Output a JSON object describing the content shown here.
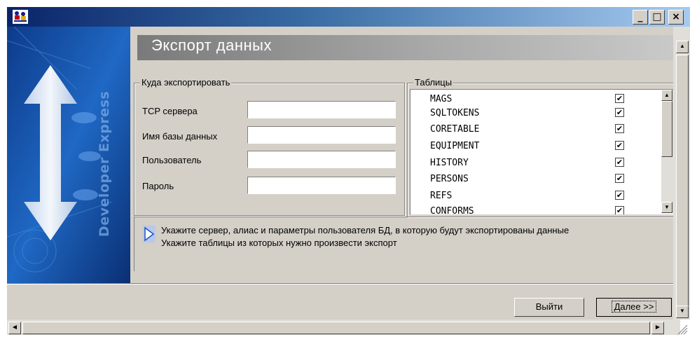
{
  "window": {
    "icon": "app-people-icon",
    "minimize_glyph": "_",
    "maximize_glyph": "□",
    "close_glyph": "×"
  },
  "sidebar_art": {
    "brand_text": "Developer Express",
    "icon": "updown-arrow-icon"
  },
  "header": {
    "title": "Экспорт данных"
  },
  "destination": {
    "legend": "Куда экспортировать",
    "fields": {
      "server_label": "TCP сервера",
      "server_value": "",
      "database_label": "Имя базы данных",
      "database_value": "",
      "user_label": "Пользователь",
      "user_value": "",
      "password_label": "Пароль",
      "password_value": ""
    }
  },
  "tables": {
    "legend": "Таблицы",
    "items": [
      {
        "name": "MAGS",
        "checked": true
      },
      {
        "name": "SQLTOKENS",
        "checked": true
      },
      {
        "name": "CORETABLE",
        "checked": true
      },
      {
        "name": "EQUIPMENT",
        "checked": true
      },
      {
        "name": "HISTORY",
        "checked": true
      },
      {
        "name": "PERSONS",
        "checked": true
      },
      {
        "name": "REFS",
        "checked": true
      },
      {
        "name": "CONFORMS",
        "checked": true
      }
    ],
    "check_glyph": "✔"
  },
  "info": {
    "icon": "play-arrow-icon",
    "line1": "Укажите сервер, алиас и параметры пользователя БД, в которую будут экспортированы данные",
    "line2": "Укажите таблицы из которых нужно произвести экспорт"
  },
  "buttons": {
    "exit_label": "Выйти",
    "next_label": "Далее >>"
  },
  "colors": {
    "titlebar_start": "#0a246a",
    "titlebar_end": "#a6caf0",
    "face": "#d4d0c8",
    "header_banner": "#8a8a8a"
  }
}
